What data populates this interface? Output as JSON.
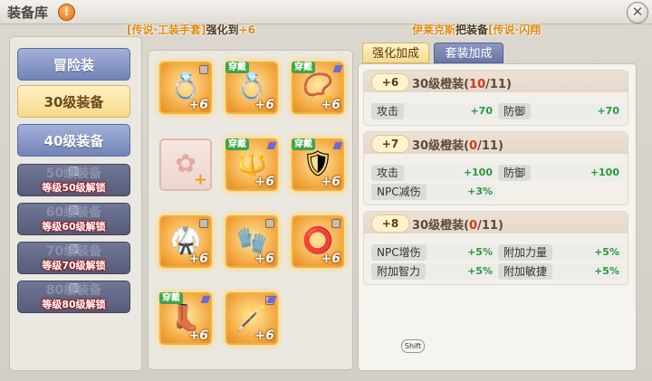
{
  "window": {
    "title": "装备库",
    "close_glyph": "✕",
    "help_glyph": "!"
  },
  "notice_left": {
    "a": "[传说·工装手套]",
    "b": "强化到",
    "c": "+6"
  },
  "notice_right": {
    "a": "伊莱克斯",
    "b": "把装备",
    "c": "[传说·闪翔"
  },
  "categories": [
    {
      "label": "冒险装",
      "state": "normal"
    },
    {
      "label": "30级装备",
      "state": "selected"
    },
    {
      "label": "40级装备",
      "state": "normal"
    },
    {
      "label": "50级装备",
      "lock_text": "等级50级解锁",
      "state": "locked"
    },
    {
      "label": "60级装备",
      "lock_text": "等级60级解锁",
      "state": "locked"
    },
    {
      "label": "70级装备",
      "lock_text": "等级70级解锁",
      "state": "locked"
    },
    {
      "label": "80级装备",
      "lock_text": "等级80级解锁",
      "state": "locked"
    }
  ],
  "items": [
    {
      "name": "ring-silver",
      "glyph": "💍",
      "plus": "+6",
      "worn": ""
    },
    {
      "name": "ring-pearl",
      "glyph": "💍",
      "plus": "+6",
      "worn": "穿戴"
    },
    {
      "name": "necklace",
      "glyph": "📿",
      "plus": "+6",
      "worn": "穿戴"
    },
    {
      "name": "empty-slot",
      "glyph": "✿",
      "plus": "+",
      "worn": ""
    },
    {
      "name": "weapon",
      "glyph": "🔱",
      "plus": "+6",
      "worn": "穿戴"
    },
    {
      "name": "shield",
      "glyph": "🛡",
      "plus": "+6",
      "worn": "穿戴"
    },
    {
      "name": "armor",
      "glyph": "🥋",
      "plus": "+6",
      "worn": ""
    },
    {
      "name": "gloves",
      "glyph": "🧤",
      "plus": "+6",
      "worn": ""
    },
    {
      "name": "belt",
      "glyph": "⭕",
      "plus": "+6",
      "worn": ""
    },
    {
      "name": "boots",
      "glyph": "👢",
      "plus": "+6",
      "worn": "穿戴"
    },
    {
      "name": "staff",
      "glyph": "🪄",
      "plus": "+6",
      "worn": ""
    }
  ],
  "tabs": {
    "active": "强化加成",
    "inactive": "套装加成"
  },
  "bonuses": [
    {
      "level": "+6",
      "name": "30级橙装",
      "count": "10",
      "total": "/11",
      "stats": [
        {
          "label": "攻击",
          "value": "+70"
        },
        {
          "label": "防御",
          "value": "+70"
        }
      ]
    },
    {
      "level": "+7",
      "name": "30级橙装",
      "count": "0",
      "total": "/11",
      "stats": [
        {
          "label": "攻击",
          "value": "+100"
        },
        {
          "label": "防御",
          "value": "+100"
        },
        {
          "label": "NPC减伤",
          "value": "+3%"
        }
      ]
    },
    {
      "level": "+8",
      "name": "30级橙装",
      "count": "0",
      "total": "/11",
      "stats": [
        {
          "label": "NPC增伤",
          "value": "+5%"
        },
        {
          "label": "附加力量",
          "value": "+5%"
        },
        {
          "label": "附加智力",
          "value": "+5%"
        },
        {
          "label": "附加敏捷",
          "value": "+5%"
        }
      ]
    }
  ],
  "shift_key": "Shift"
}
